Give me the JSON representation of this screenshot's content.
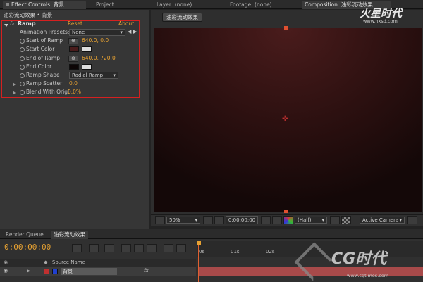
{
  "top_tabs": {
    "effect_controls": "Effect Controls: 背景",
    "project": "Project",
    "layer": "Layer: (none)",
    "footage": "Footage: (none)",
    "composition": "Composition: 油彩流动效果"
  },
  "effect_panel": {
    "breadcrumb": "油彩流动效果 • 背景",
    "effect_name": "Ramp",
    "reset": "Reset",
    "about": "About...",
    "animation_presets_label": "Animation Presets:",
    "animation_presets_value": "None",
    "start_of_ramp_label": "Start of Ramp",
    "start_of_ramp_value": "640.0, 0.0",
    "start_color_label": "Start Color",
    "end_of_ramp_label": "End of Ramp",
    "end_of_ramp_value": "640.0, 720.0",
    "end_color_label": "End Color",
    "ramp_shape_label": "Ramp Shape",
    "ramp_shape_value": "Radial Ramp",
    "ramp_scatter_label": "Ramp Scatter",
    "ramp_scatter_value": "0.0",
    "blend_label": "Blend With Origi",
    "blend_value": "0.0%"
  },
  "colors": {
    "start_color": "#4a1c1c",
    "end_color": "#0d0606",
    "highlight": "#d62020"
  },
  "comp_viewer": {
    "comp_tab": "油彩流动效果",
    "zoom": "50%",
    "timecode": "0:00:00:00",
    "resolution": "(Half)",
    "camera": "Active Camera"
  },
  "timeline": {
    "tab_render_queue": "Render Queue",
    "tab_comp": "油彩流动效果",
    "timecode": "0:00:00:00",
    "col_source_name": "Source Name",
    "layer_number": "1",
    "layer_name": "背景",
    "ruler": [
      "0s",
      "01s",
      "02s"
    ]
  },
  "watermarks": {
    "top_brand": "火星时代",
    "top_url": "www.hxsd.com",
    "bottom_brand": "CG时代",
    "bottom_url": "www.cgtimes.com"
  },
  "icons": [
    "fx-icon",
    "stopwatch-icon",
    "crosshair-icon",
    "eyedropper-icon",
    "eye-icon",
    "camera-icon"
  ]
}
